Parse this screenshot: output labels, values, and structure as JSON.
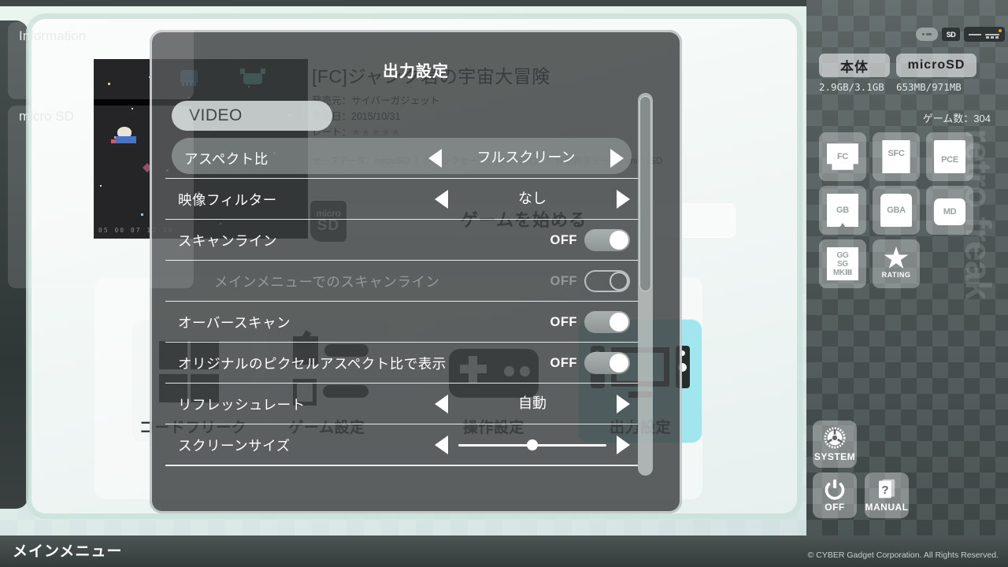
{
  "window": {
    "bottom_bar_title": "メインメニュー",
    "copyright": "© CYBER Gadget Corporation. All Rights Reserved."
  },
  "game_info": {
    "title": "[FC]ジャンク君の宇宙大冒険",
    "publisher_line": "発売元：サイバーガジェット",
    "release_line": "発売日：2015/10/31",
    "rate_label": "レート：",
    "rate_stars": "★★★★★",
    "save_line": "セーブデータ：microSD ｜ クイックセーブ：microSD(1) ｜ 自動再開データ：microSD",
    "start_label": "ゲームを始める",
    "media_badge_top": "micro",
    "media_badge_bottom": "SD",
    "thumb_hud": "05  00  07  12  38"
  },
  "menu_tiles": [
    {
      "label": "コードフリーク",
      "selected": false
    },
    {
      "label": "ゲーム設定",
      "selected": false
    },
    {
      "label": "操作設定",
      "selected": false
    },
    {
      "label": "出力設定",
      "selected": true
    }
  ],
  "dialog": {
    "title": "出力設定",
    "section_header": "VIDEO",
    "rows": [
      {
        "label": "アスペクト比",
        "control": "spinner",
        "value": "フルスクリーン",
        "selected": true,
        "disabled": false
      },
      {
        "label": "映像フィルター",
        "control": "spinner",
        "value": "なし",
        "selected": false,
        "disabled": false
      },
      {
        "label": "スキャンライン",
        "control": "toggle",
        "value": "OFF",
        "selected": false,
        "disabled": false
      },
      {
        "label": "メインメニューでのスキャンライン",
        "control": "toggle",
        "value": "OFF",
        "selected": false,
        "disabled": true
      },
      {
        "label": "オーバースキャン",
        "control": "toggle",
        "value": "OFF",
        "selected": false,
        "disabled": false
      },
      {
        "label": "オリジナルのピクセルアスペクト比で表示",
        "control": "toggle",
        "value": "OFF",
        "selected": false,
        "disabled": false
      },
      {
        "label": "リフレッシュレート",
        "control": "spinner",
        "value": "自動",
        "selected": false,
        "disabled": false
      },
      {
        "label": "スクリーンサイズ",
        "control": "slider",
        "value": "50",
        "selected": false,
        "disabled": false
      }
    ],
    "scroll_position": "top"
  },
  "sidebar": {
    "information_title": "Information",
    "header_icons": [
      "sd-slot-icon",
      "sd-card-icon",
      "device-status-icon"
    ],
    "storage": [
      {
        "label": "本体",
        "usage": "2.9GB/3.1GB"
      },
      {
        "label": "microSD",
        "usage": "653MB/971MB"
      }
    ],
    "source_title": "micro SD",
    "game_count_label": "ゲーム数：304",
    "system_filters": [
      {
        "label": "FC"
      },
      {
        "label": "SFC"
      },
      {
        "label": "PCE"
      },
      {
        "label": "GB"
      },
      {
        "label": "GBA"
      },
      {
        "label": "MD"
      },
      {
        "label": "GG\nSG\nMKⅢ"
      },
      {
        "label": "RATING"
      }
    ],
    "brand_text": "retro freak",
    "corner_buttons": [
      {
        "label": "SYSTEM",
        "icon": "gear-icon"
      },
      {
        "label": "OFF",
        "icon": "power-icon"
      },
      {
        "label": "MANUAL",
        "icon": "manual-book-icon"
      }
    ]
  },
  "colors": {
    "accent_cyan": "#9fe6ee",
    "sidebar_dark": "#4a5352",
    "dialog_overlay": "rgba(62,66,66,.84)",
    "bg_mint": "#e9f5ee",
    "led_orange": "#f0a020"
  }
}
